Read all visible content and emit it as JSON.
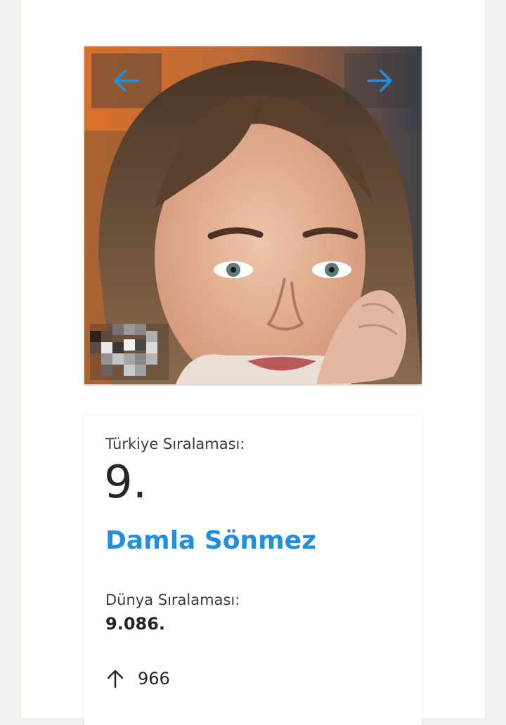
{
  "gallery": {
    "prev_icon": "arrow-left-icon",
    "next_icon": "arrow-right-icon",
    "accent_color": "#1f8fe0"
  },
  "ranking": {
    "turkey_label": "Türkiye Sıralaması:",
    "turkey_rank": "9.",
    "name": "Damla Sönmez",
    "world_label": "Dünya Sıralaması:",
    "world_rank": "9.086.",
    "change_icon": "arrow-up-icon",
    "change_value": "966"
  }
}
